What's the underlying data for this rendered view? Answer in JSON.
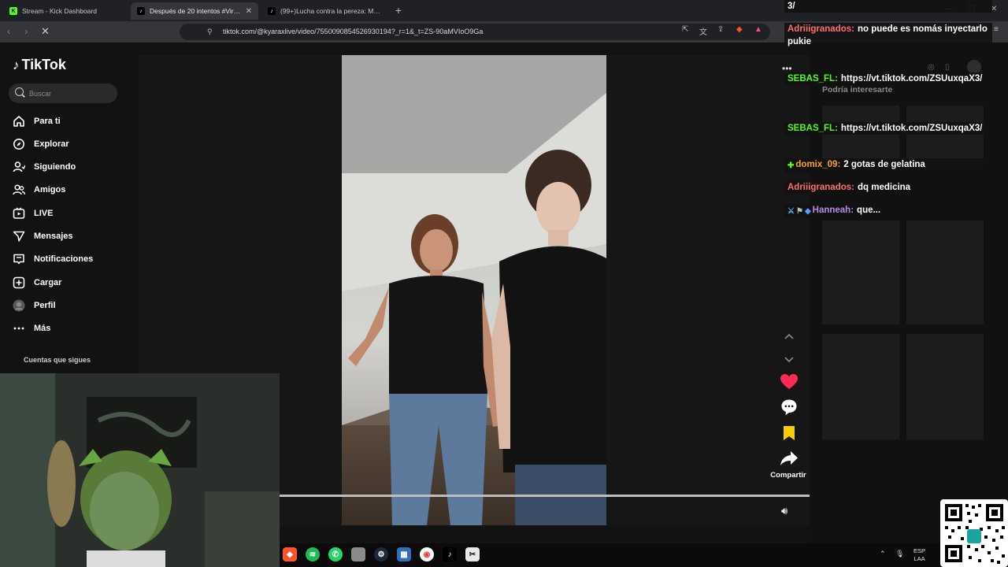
{
  "browser": {
    "tabs": [
      {
        "title": "Stream - Kick Dashboard",
        "active": false,
        "favicon": "kick-icon"
      },
      {
        "title": "Después de 20 intentos #Viral #",
        "active": true,
        "favicon": "tiktok-icon"
      },
      {
        "title": "(99+)Lucha contra la pereza: Motivac",
        "active": false,
        "favicon": "tiktok-icon"
      }
    ],
    "url": "tiktok.com/@kyaraxlive/video/7550090854526930194?_r=1&_t=ZS-90aMVIoO9Ga"
  },
  "tiktok": {
    "brand": "TikTok",
    "search_placeholder": "Buscar",
    "nav": [
      {
        "label": "Para ti",
        "icon": "home-icon"
      },
      {
        "label": "Explorar",
        "icon": "compass-icon"
      },
      {
        "label": "Siguiendo",
        "icon": "user-follow-icon"
      },
      {
        "label": "Amigos",
        "icon": "friends-icon"
      },
      {
        "label": "LIVE",
        "icon": "live-icon"
      },
      {
        "label": "Mensajes",
        "icon": "send-icon"
      },
      {
        "label": "Notificaciones",
        "icon": "inbox-icon"
      },
      {
        "label": "Cargar",
        "icon": "upload-icon"
      },
      {
        "label": "Perfil",
        "icon": "avatar-icon"
      },
      {
        "label": "Más",
        "icon": "more-icon"
      }
    ],
    "following_heading": "Cuentas que sigues",
    "share_label": "Compartir",
    "suggest_heading": "Podría interesarte"
  },
  "chat": {
    "messages": [
      {
        "user": "",
        "text": "3/",
        "color": "#ffffff"
      },
      {
        "user": "Adriiigranados:",
        "text": "no puede es nomás inyectarlo pukie",
        "color": "#ff6f6f"
      },
      {
        "user": "SEBAS_FL:",
        "text": "https://vt.tiktok.com/ZSUuxqaX3/",
        "color": "#53fc18"
      },
      {
        "user": "SEBAS_FL:",
        "text": "https://vt.tiktok.com/ZSUuxqaX3/",
        "color": "#53fc18"
      },
      {
        "user": "domix_09:",
        "text": "2 gotas de gelatina",
        "color": "#f5a623"
      },
      {
        "user": "Adriiigranados:",
        "text": "dq medicina",
        "color": "#ff6f6f"
      },
      {
        "user": "Hanneah:",
        "text": "que...",
        "color": "#b48ee0"
      }
    ]
  },
  "taskbar": {
    "lang_line1": "ESP",
    "lang_line2": "LAA"
  },
  "colors": {
    "like": "#fe2c55",
    "bookmark": "#facd00",
    "kick_green": "#53fc18"
  }
}
